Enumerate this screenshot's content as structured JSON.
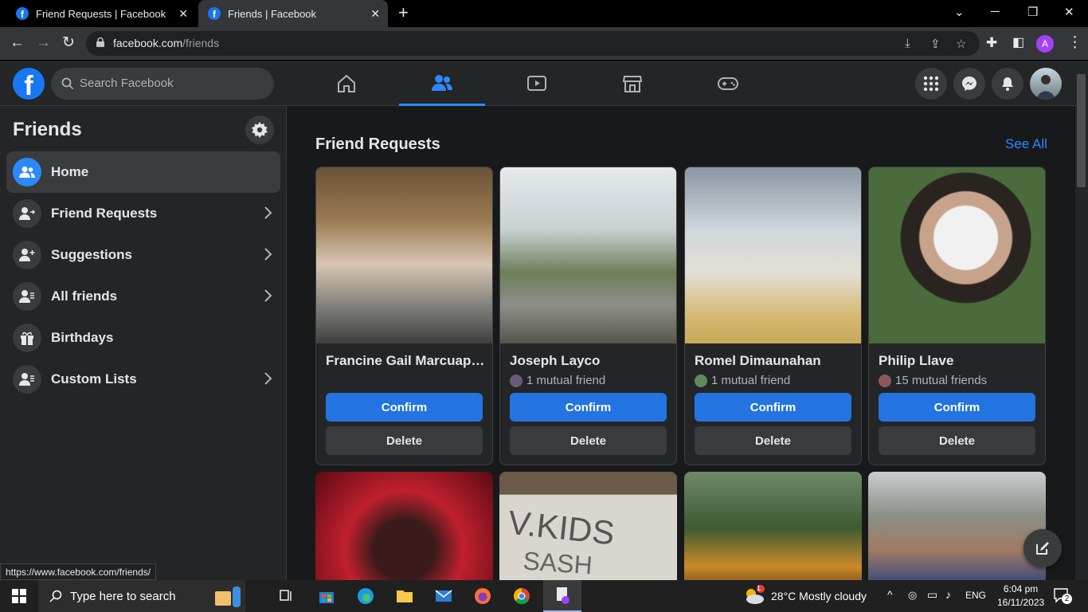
{
  "browser": {
    "tabs": [
      {
        "title": "Friend Requests | Facebook"
      },
      {
        "title": "Friends | Facebook"
      }
    ],
    "url_host": "facebook.com",
    "url_path": "/friends",
    "status_url": "https://www.facebook.com/friends/",
    "profile_initial": "A"
  },
  "header": {
    "logo": "f",
    "search_placeholder": "Search Facebook"
  },
  "sidebar": {
    "title": "Friends",
    "items": [
      {
        "label": "Home",
        "icon": "people-icon",
        "active": true
      },
      {
        "label": "Friend Requests",
        "icon": "person-arrow-icon",
        "chevron": true
      },
      {
        "label": "Suggestions",
        "icon": "person-plus-icon",
        "chevron": true
      },
      {
        "label": "All friends",
        "icon": "person-list-icon",
        "chevron": true
      },
      {
        "label": "Birthdays",
        "icon": "gift-icon"
      },
      {
        "label": "Custom Lists",
        "icon": "person-list-icon",
        "chevron": true
      }
    ]
  },
  "main": {
    "section_title": "Friend Requests",
    "see_all": "See All",
    "requests": [
      {
        "name": "Francine Gail Marcuap ...",
        "mutual": "",
        "confirm": "Confirm",
        "delete": "Delete"
      },
      {
        "name": "Joseph Layco",
        "mutual": "1 mutual friend",
        "confirm": "Confirm",
        "delete": "Delete"
      },
      {
        "name": "Romel Dimaunahan",
        "mutual": "1 mutual friend",
        "confirm": "Confirm",
        "delete": "Delete"
      },
      {
        "name": "Philip Llave",
        "mutual": "15 mutual friends",
        "confirm": "Confirm",
        "delete": "Delete"
      }
    ]
  },
  "taskbar": {
    "search_placeholder": "Type here to search",
    "weather": "28°C  Mostly cloudy",
    "weather_badge": "1",
    "language": "ENG",
    "time": "6:04 pm",
    "date": "16/11/2023",
    "notifications": "2"
  },
  "colors": {
    "accent": "#2374e1",
    "link": "#2d88ff",
    "background": "#18191a",
    "surface": "#242526"
  }
}
